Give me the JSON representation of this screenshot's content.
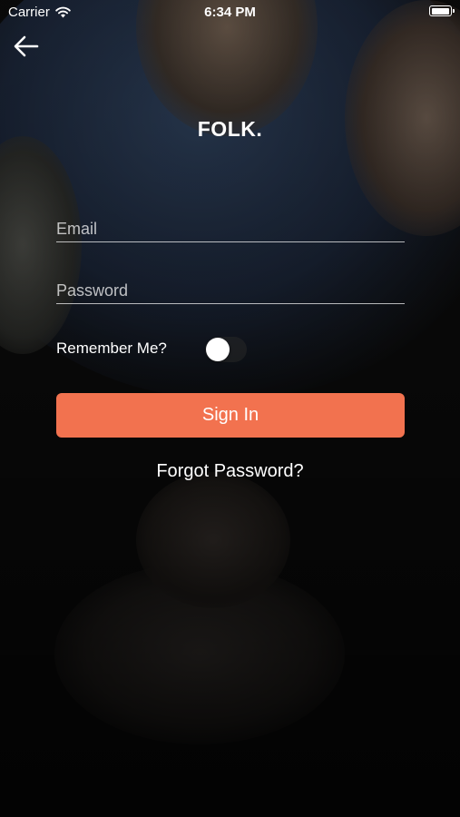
{
  "status_bar": {
    "carrier": "Carrier",
    "time": "6:34 PM",
    "battery_level": 1.0
  },
  "nav": {
    "back_icon": "arrow-left-icon"
  },
  "brand": {
    "logo_text": "FOLK."
  },
  "form": {
    "email": {
      "placeholder": "Email",
      "value": ""
    },
    "password": {
      "placeholder": "Password",
      "value": ""
    },
    "remember_label": "Remember Me?",
    "remember_on": false,
    "sign_in_label": "Sign In",
    "forgot_label": "Forgot Password?"
  },
  "colors": {
    "accent": "#f2724f"
  }
}
